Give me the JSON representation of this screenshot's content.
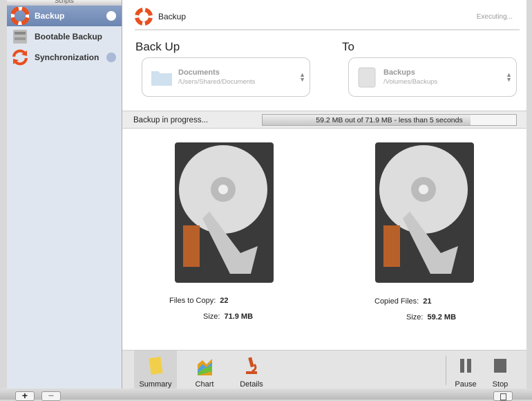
{
  "sidebar": {
    "header": "Scripts",
    "items": [
      {
        "label": "Backup"
      },
      {
        "label": "Bootable Backup"
      },
      {
        "label": "Synchronization"
      }
    ]
  },
  "header": {
    "title": "Backup",
    "status": "Executing..."
  },
  "source": {
    "label": "Back Up",
    "name": "Documents",
    "path": "/Users/Shared/Documents"
  },
  "dest": {
    "label": "To",
    "name": "Backups",
    "path": "/Volumes/Backups"
  },
  "progress": {
    "status": "Backup in progress...",
    "text": "59.2 MB out of 71.9 MB - less than 5 seconds",
    "percent": 82
  },
  "left_stats": {
    "files_label": "Files to Copy:",
    "files": "22",
    "size_label": "Size:",
    "size": "71.9 MB"
  },
  "right_stats": {
    "files_label": "Copied Files:",
    "files": "21",
    "size_label": "Size:",
    "size": "59.2 MB"
  },
  "toolbar": {
    "summary": "Summary",
    "chart": "Chart",
    "details": "Details",
    "pause": "Pause",
    "stop": "Stop"
  },
  "bottom": {
    "add": "+",
    "remove": "−"
  },
  "colors": {
    "accent": "#e8501e",
    "selection": "#7a91bb"
  }
}
